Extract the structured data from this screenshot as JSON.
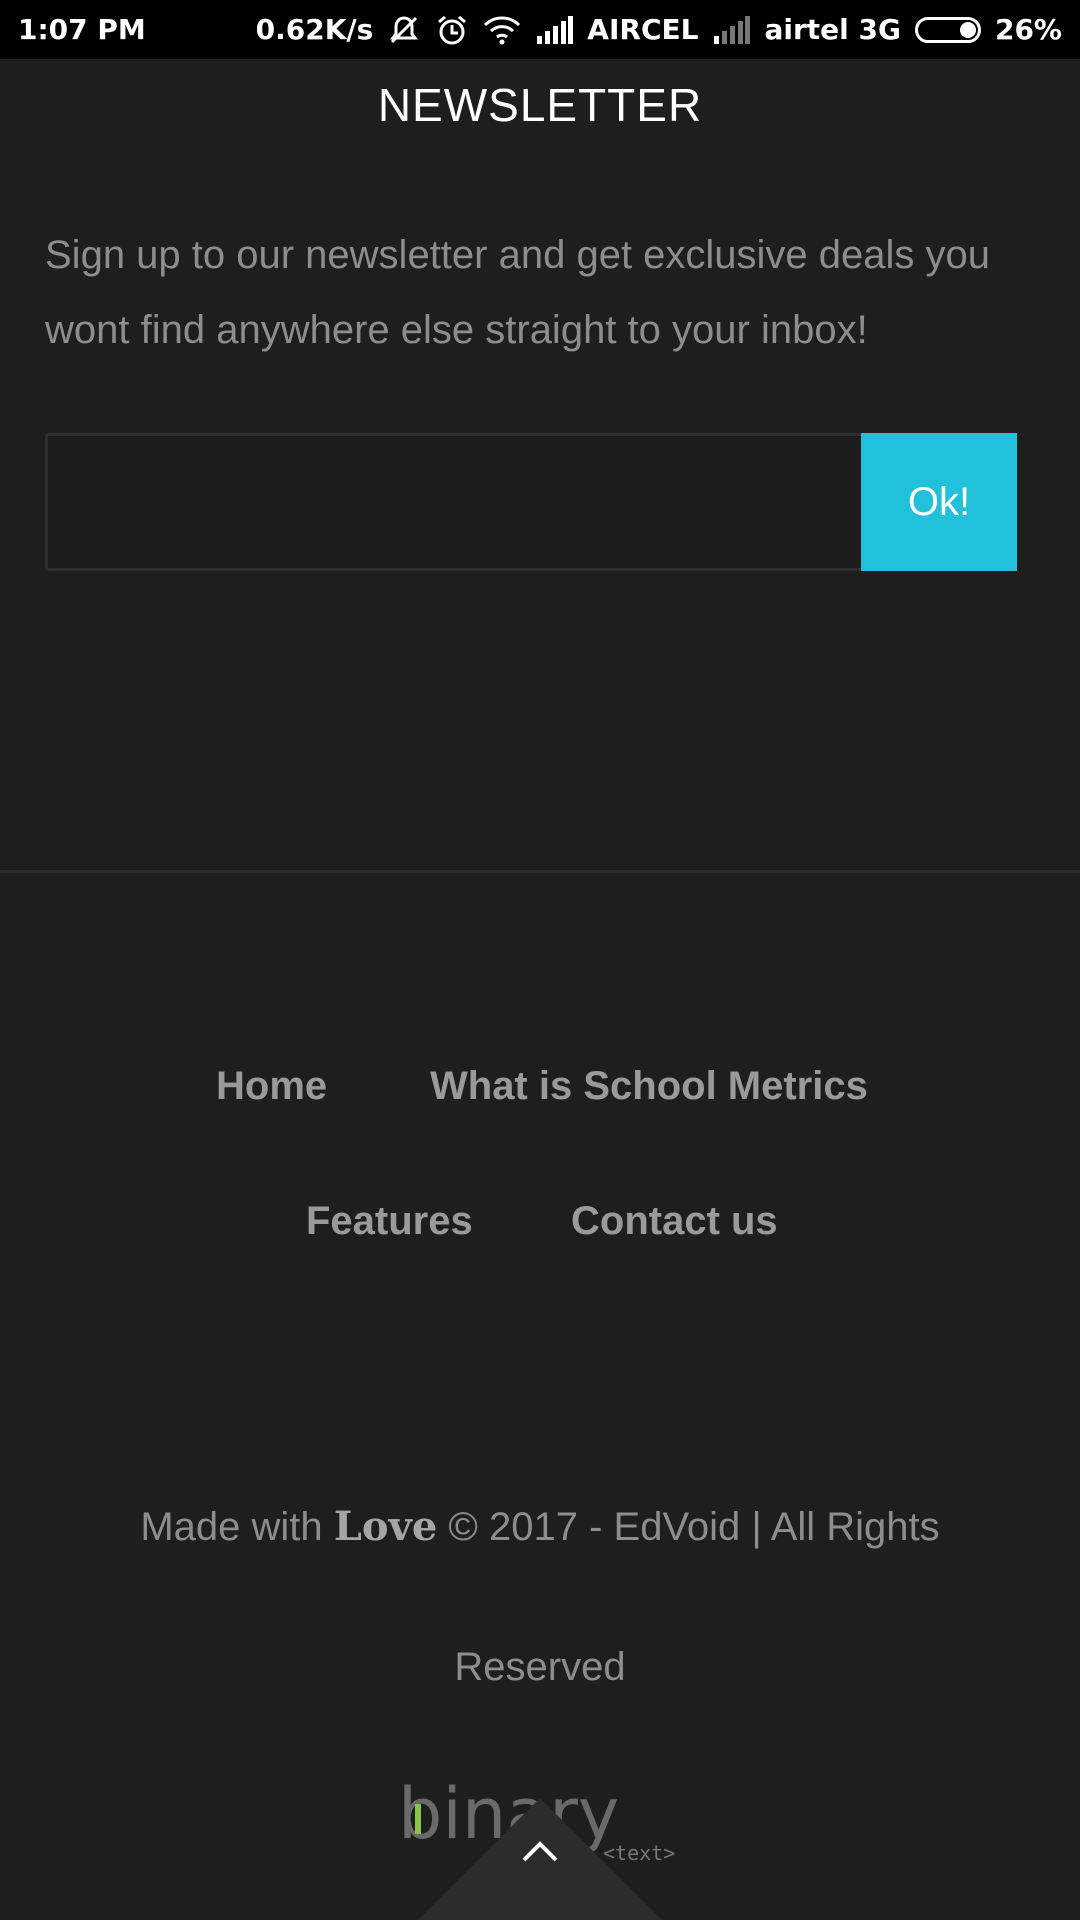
{
  "status_bar": {
    "time": "1:07 PM",
    "speed": "0.62K/s",
    "carrier1": "AIRCEL",
    "carrier2": "airtel 3G",
    "battery": "26%"
  },
  "newsletter": {
    "title": "NEWSLETTER",
    "description": "Sign up to our newsletter and get exclusive deals you wont find anywhere else straight to your inbox!",
    "email_value": "",
    "submit_label": "Ok!",
    "accent_color": "#22c1db"
  },
  "footer": {
    "nav": [
      "Home",
      "What is School Metrics",
      "Features",
      "Contact us"
    ],
    "credit_prefix": "Made with",
    "credit_love": "Love",
    "credit_suffix": "© 2017 - EdVoid | All Rights",
    "credit_line2": "Reserved",
    "logo_text": "binary",
    "logo_tag": "<text>"
  },
  "icons": [
    "mute-icon",
    "alarm-icon",
    "wifi-icon",
    "signal-icon",
    "battery-icon",
    "chevron-up-icon"
  ]
}
